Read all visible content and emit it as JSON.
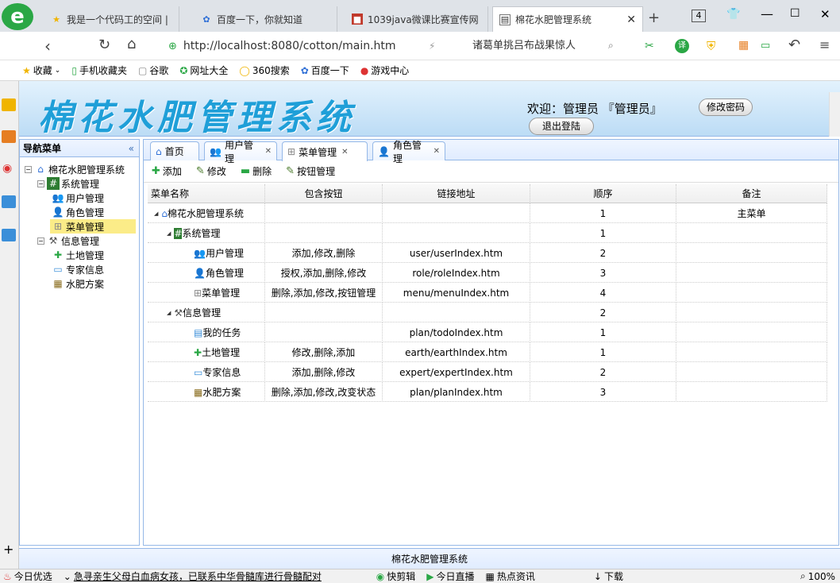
{
  "browser": {
    "tabs": [
      {
        "label": "我是一个代码工的空间 |"
      },
      {
        "label": "百度一下，你就知道"
      },
      {
        "label": "1039java微课比赛宣传网"
      },
      {
        "label": "棉花水肥管理系统"
      }
    ],
    "tab_count": "4",
    "url": "http://localhost:8080/cotton/main.htm",
    "search_text": "诸葛单挑吕布战果惊人",
    "bookmarks": [
      {
        "label": "收藏",
        "icon": "star-icon"
      },
      {
        "label": "手机收藏夹",
        "icon": "phone-icon"
      },
      {
        "label": "谷歌",
        "icon": "page-icon"
      },
      {
        "label": "网址大全",
        "icon": "compass-icon"
      },
      {
        "label": "360搜索",
        "icon": "search-ring-icon"
      },
      {
        "label": "百度一下",
        "icon": "paw-icon"
      },
      {
        "label": "游戏中心",
        "icon": "game-icon"
      }
    ]
  },
  "header": {
    "system_title": "棉花水肥管理系统",
    "welcome": "欢迎：管理员 『管理员』",
    "change_password": "修改密码",
    "logout": "退出登陆"
  },
  "west": {
    "title": "导航菜单",
    "tree": [
      {
        "label": "棉花水肥管理系统",
        "level": 0,
        "icon": "home-icon"
      },
      {
        "label": "系统管理",
        "level": 1,
        "icon": "hash-icon"
      },
      {
        "label": "用户管理",
        "level": 2,
        "icon": "users-icon"
      },
      {
        "label": "角色管理",
        "level": 2,
        "icon": "user-icon"
      },
      {
        "label": "菜单管理",
        "level": 2,
        "icon": "sitemap-icon",
        "selected": true
      },
      {
        "label": "信息管理",
        "level": 1,
        "icon": "tools-icon"
      },
      {
        "label": "土地管理",
        "level": 2,
        "icon": "plus-icon"
      },
      {
        "label": "专家信息",
        "level": 2,
        "icon": "card-icon"
      },
      {
        "label": "水肥方案",
        "level": 2,
        "icon": "grid-icon"
      }
    ]
  },
  "center": {
    "tabs": [
      {
        "label": "首页",
        "icon": "home-icon",
        "closable": false
      },
      {
        "label": "用户管理",
        "icon": "users-icon",
        "closable": true
      },
      {
        "label": "菜单管理",
        "icon": "sitemap-icon",
        "closable": true,
        "active": true
      },
      {
        "label": "角色管理",
        "icon": "user-icon",
        "closable": true
      }
    ],
    "toolbar": {
      "add": "添加",
      "edit": "修改",
      "delete": "删除",
      "button_manage": "按钮管理"
    },
    "columns": [
      "菜单名称",
      "包含按钮",
      "链接地址",
      "顺序",
      "备注"
    ],
    "rows": [
      {
        "name": "棉花水肥管理系统",
        "level": 0,
        "icon": "home-icon",
        "buttons": "",
        "url": "",
        "order": "1",
        "remark": "主菜单"
      },
      {
        "name": "系统管理",
        "level": 1,
        "icon": "hash-icon",
        "buttons": "",
        "url": "",
        "order": "1",
        "remark": ""
      },
      {
        "name": "用户管理",
        "level": 2,
        "icon": "users-icon",
        "buttons": "添加,修改,删除",
        "url": "user/userIndex.htm",
        "order": "2",
        "remark": ""
      },
      {
        "name": "角色管理",
        "level": 2,
        "icon": "user-icon",
        "buttons": "授权,添加,删除,修改",
        "url": "role/roleIndex.htm",
        "order": "3",
        "remark": ""
      },
      {
        "name": "菜单管理",
        "level": 2,
        "icon": "sitemap-icon",
        "buttons": "删除,添加,修改,按钮管理",
        "url": "menu/menuIndex.htm",
        "order": "4",
        "remark": ""
      },
      {
        "name": "信息管理",
        "level": 1,
        "icon": "tools-icon",
        "buttons": "",
        "url": "",
        "order": "2",
        "remark": ""
      },
      {
        "name": "我的任务",
        "level": 2,
        "icon": "doc-icon",
        "buttons": "",
        "url": "plan/todoIndex.htm",
        "order": "1",
        "remark": ""
      },
      {
        "name": "土地管理",
        "level": 2,
        "icon": "plus-icon",
        "buttons": "修改,删除,添加",
        "url": "earth/earthIndex.htm",
        "order": "1",
        "remark": ""
      },
      {
        "name": "专家信息",
        "level": 2,
        "icon": "card-icon",
        "buttons": "添加,删除,修改",
        "url": "expert/expertIndex.htm",
        "order": "2",
        "remark": ""
      },
      {
        "name": "水肥方案",
        "level": 2,
        "icon": "grid-icon",
        "buttons": "删除,添加,修改,改变状态",
        "url": "plan/planIndex.htm",
        "order": "3",
        "remark": ""
      }
    ]
  },
  "footer": {
    "text": "棉花水肥管理系统"
  },
  "statusbar": {
    "items": [
      "今日优选",
      "急寻亲生父母白血病女孩，已联系中华骨髓库进行骨髓配对",
      "快剪辑",
      "今日直播",
      "热点资讯",
      "下载",
      "100%"
    ]
  },
  "colors": {
    "accent": "#95b8e7",
    "title": "#1f9fd8",
    "selected": "#fbec88"
  }
}
